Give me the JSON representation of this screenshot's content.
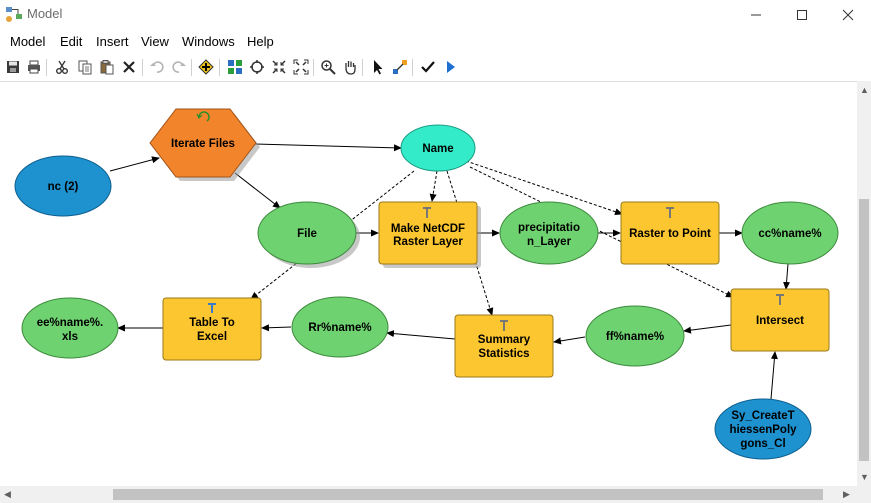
{
  "window": {
    "title": "Model"
  },
  "menu": [
    "Model",
    "Edit",
    "Insert",
    "View",
    "Windows",
    "Help"
  ],
  "toolbar": {
    "buttons": [
      "save-icon",
      "print-icon",
      "cut-icon",
      "copy-icon",
      "paste-icon",
      "delete-icon",
      "undo-icon",
      "redo-icon",
      "add-data-icon",
      "auto-layout-icon",
      "full-extent-icon",
      "fixed-zoom-in-icon",
      "fixed-zoom-out-icon",
      "zoom-in-icon",
      "pan-icon",
      "select-icon",
      "connect-icon",
      "validate-icon",
      "run-icon"
    ]
  },
  "nodes": {
    "iterate_files": "Iterate Files",
    "nc2": "nc (2)",
    "name": "Name",
    "file": "File",
    "make_netcdf": [
      "Make NetCDF",
      "Raster Layer"
    ],
    "precip_layer": [
      "precipitatio",
      "n_Layer"
    ],
    "raster_to_point": "Raster to Point",
    "cc_name": "cc%name%",
    "intersect": "Intersect",
    "ff_name": "ff%name%",
    "summary_stats": [
      "Summary",
      "Statistics"
    ],
    "rr_name": "Rr%name%",
    "table_to_excel": [
      "Table To",
      "Excel"
    ],
    "ee_name": [
      "ee%name%.",
      "xls"
    ],
    "sy_thiessen": [
      "Sy_CreateT",
      "hiessenPoly",
      "gons_Cl"
    ]
  },
  "colors": {
    "tool": "#fcc630",
    "derived_data": "#6fd270",
    "input_data": "#1e91cf",
    "iterator": "#f2852b",
    "variable": "#33ebc8"
  }
}
